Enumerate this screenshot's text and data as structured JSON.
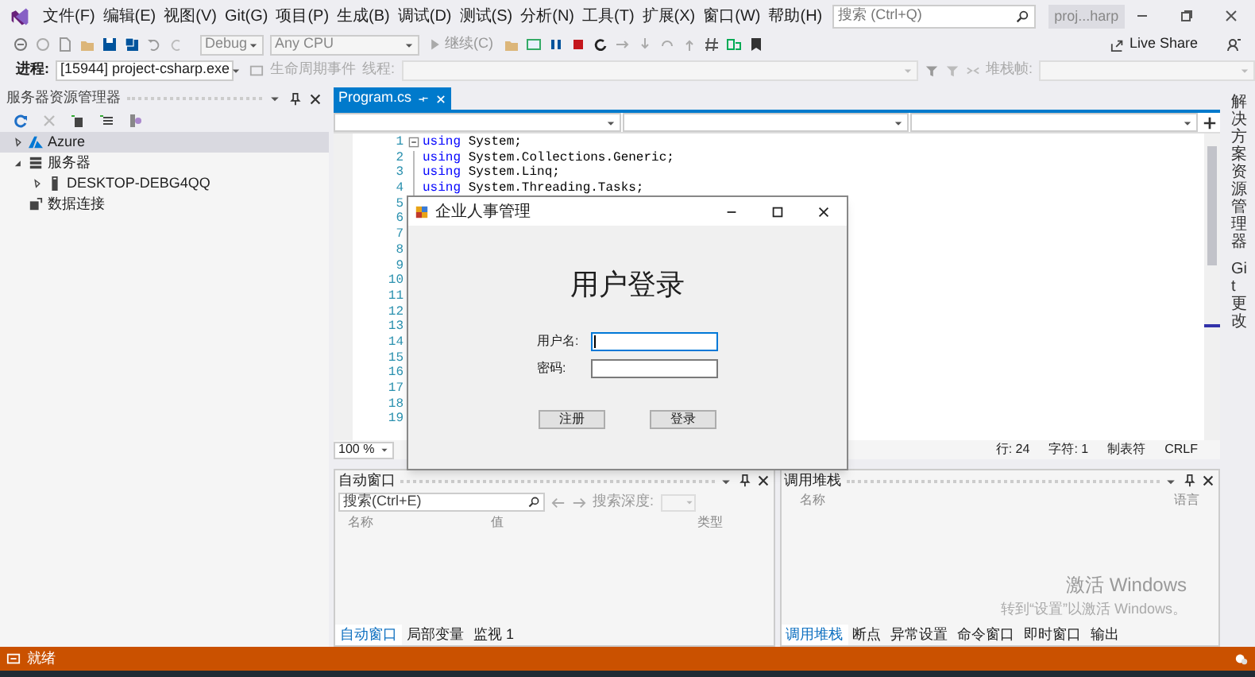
{
  "menu": [
    "文件(F)",
    "编辑(E)",
    "视图(V)",
    "Git(G)",
    "项目(P)",
    "生成(B)",
    "调试(D)",
    "测试(S)",
    "分析(N)",
    "工具(T)",
    "扩展(X)",
    "窗口(W)",
    "帮助(H)"
  ],
  "search": {
    "placeholder": "搜索 (Ctrl+Q)"
  },
  "solution_badge": "proj...harp",
  "toolbar": {
    "configuration": "Debug",
    "platform": "Any CPU",
    "continue_button": "继续(C)",
    "live_share": "Live Share"
  },
  "debug_location": {
    "process_label": "进程:",
    "process": "[15944] project-csharp.exe",
    "lifecycle_events": "生命周期事件",
    "thread_label": "线程:",
    "stack_frame_label": "堆栈帧:"
  },
  "server_explorer": {
    "title": "服务器资源管理器",
    "tree": [
      {
        "label": "Azure",
        "kind": "azure",
        "expanded": false,
        "selected": true
      },
      {
        "label": "服务器",
        "kind": "servers",
        "expanded": true,
        "selected": false,
        "children": [
          {
            "label": "DESKTOP-DEBG4QQ",
            "kind": "computer",
            "expanded": false,
            "selected": false
          }
        ]
      },
      {
        "label": "数据连接",
        "kind": "data-connections",
        "selected": false
      }
    ]
  },
  "editor": {
    "tab": {
      "label": "Program.cs",
      "selected": true
    },
    "lines": [
      {
        "number": "1",
        "folded": false,
        "code": [
          {
            "text": "using",
            "kind": "keyword"
          },
          {
            "text": " System;",
            "kind": "plain"
          }
        ]
      },
      {
        "number": "2",
        "code": [
          {
            "text": "using",
            "kind": "keyword"
          },
          {
            "text": " System.Collections.Generic;",
            "kind": "plain"
          }
        ]
      },
      {
        "number": "3",
        "code": [
          {
            "text": "using",
            "kind": "keyword"
          },
          {
            "text": " System.Linq;",
            "kind": "plain"
          }
        ]
      },
      {
        "number": "4",
        "code": [
          {
            "text": "using",
            "kind": "keyword"
          },
          {
            "text": " System.Threading.Tasks;",
            "kind": "plain"
          }
        ]
      },
      {
        "number": "5"
      },
      {
        "number": "6"
      },
      {
        "number": "7"
      },
      {
        "number": "8"
      },
      {
        "number": "9"
      },
      {
        "number": "10"
      },
      {
        "number": "11"
      },
      {
        "number": "12"
      },
      {
        "number": "13"
      },
      {
        "number": "14"
      },
      {
        "number": "15"
      },
      {
        "number": "16"
      },
      {
        "number": "17"
      },
      {
        "number": "18"
      },
      {
        "number": "19"
      }
    ],
    "zoom": "100 %",
    "status": [
      "行: 24",
      "字符: 1",
      "制表符",
      "CRLF"
    ]
  },
  "right_tabs": [
    "解决方案资源管理器",
    "Git 更改"
  ],
  "autos": {
    "title": "自动窗口",
    "search_placeholder": "搜索(Ctrl+E)",
    "depth_label": "搜索深度:",
    "columns": [
      "名称",
      "值",
      "类型"
    ],
    "tabs": [
      {
        "label": "自动窗口",
        "selected": true
      },
      {
        "label": "局部变量",
        "selected": false
      },
      {
        "label": "监视 1",
        "selected": false
      }
    ]
  },
  "call_stack": {
    "title": "调用堆栈",
    "columns": [
      "名称",
      "语言"
    ],
    "tabs": [
      {
        "label": "调用堆栈",
        "selected": true
      },
      {
        "label": "断点",
        "selected": false
      },
      {
        "label": "异常设置",
        "selected": false
      },
      {
        "label": "命令窗口",
        "selected": false
      },
      {
        "label": "即时窗口",
        "selected": false
      },
      {
        "label": "输出",
        "selected": false
      }
    ]
  },
  "activation_notice": {
    "title": "激活 Windows",
    "text": "转到“设置”以激活 Windows。"
  },
  "status_bar": "就绪",
  "dialog": {
    "title": "企业人事管理",
    "heading": "用户登录",
    "fields": [
      {
        "label": "用户名:",
        "focused": true
      },
      {
        "label": "密码:",
        "focused": false
      }
    ],
    "buttons": [
      "注册",
      "登录"
    ]
  }
}
